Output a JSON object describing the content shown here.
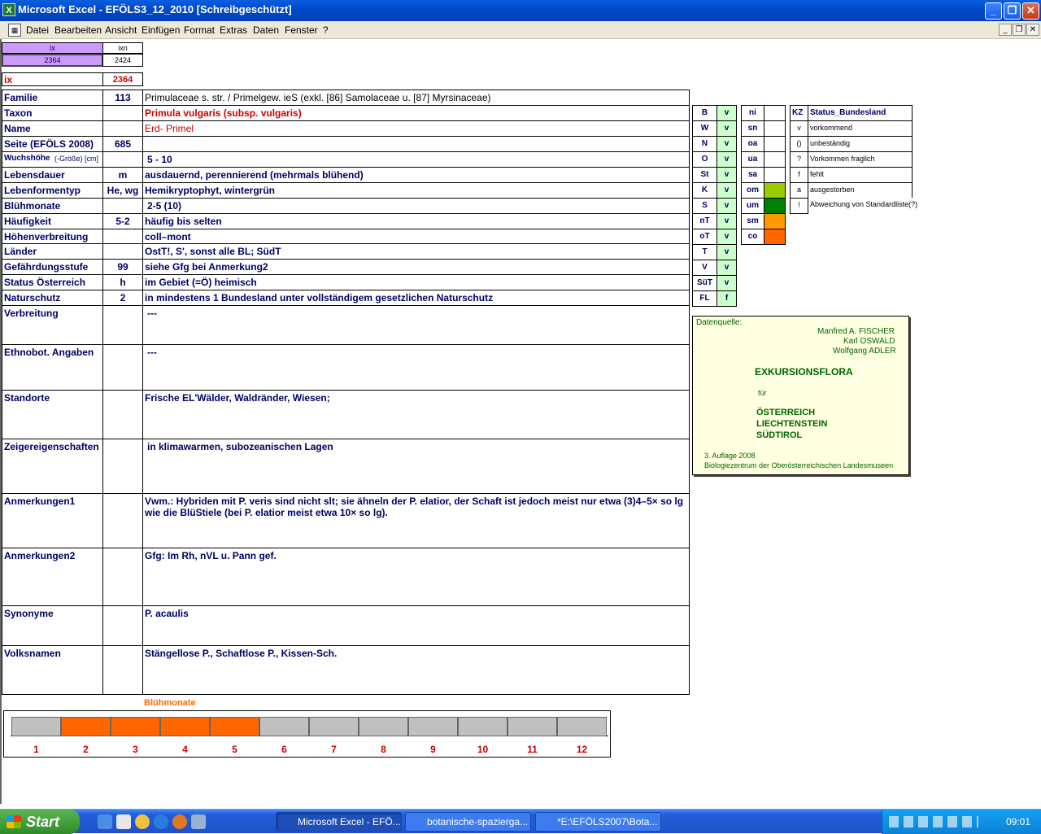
{
  "window": {
    "title": "Microsoft Excel - EFÖLS3_12_2010  [Schreibgeschützt]",
    "app_icon": "X"
  },
  "menu": [
    "Datei",
    "Bearbeiten",
    "Ansicht",
    "Einfügen",
    "Format",
    "Extras",
    "Daten",
    "Fenster",
    "?"
  ],
  "top": {
    "ix_header": "ix",
    "ixn_header": "ixn",
    "ix_value": "2364",
    "ixn_value": "2424",
    "ix_label": "ix",
    "ix_red": "2364"
  },
  "rows": [
    {
      "label": "Familie",
      "code": "113",
      "value": "Primulaceae s. str.  /  Primelgew. ieS (exkl. [86] Samolaceae u. [87] Myrsinaceae)"
    },
    {
      "label": "Taxon",
      "code": "",
      "value": "Primula vulgaris (subsp. vulgaris)"
    },
    {
      "label": "Name",
      "code": "",
      "value": "Erd- Primel"
    },
    {
      "label": "Seite (EFÖLS 2008)",
      "code": "685",
      "value": ""
    },
    {
      "label": "Wuchshöhe",
      "label_small": "(-Größe) [cm]",
      "code": "",
      "value": "5 - 10"
    },
    {
      "label": "Lebensdauer",
      "code": "m",
      "value": "ausdauernd, perennierend (mehrmals blühend)"
    },
    {
      "label": "Lebenformentyp",
      "code": "He, wg",
      "value": "Hemikryptophyt, wintergrün"
    },
    {
      "label": "Blühmonate",
      "code": "",
      "value": "2-5 (10)"
    },
    {
      "label": "Häufigkeit",
      "code": "5-2",
      "value": "häufig bis selten"
    },
    {
      "label": "Höhenverbreitung",
      "code": "",
      "value": "coll–mont"
    },
    {
      "label": "Länder",
      "code": "",
      "value": "OstT!, S', sonst alle BL; SüdT"
    },
    {
      "label": "Gefährdungsstufe",
      "code": "99",
      "value": "siehe Gfg bei Anmerkung2"
    },
    {
      "label": "Status Österreich",
      "code": "h",
      "value": "im Gebiet (=Ö) heimisch"
    },
    {
      "label": "Naturschutz",
      "code": "2",
      "value": "in mindestens 1 Bundesland unter vollständigem gesetzlichen Naturschutz"
    },
    {
      "label": "Verbreitung",
      "code": "",
      "value": "---"
    },
    {
      "label": "Ethnobot. Angaben",
      "code": "",
      "value": "---"
    },
    {
      "label": "Standorte",
      "code": "",
      "value": "Frische EL'Wälder, Waldränder, Wiesen;"
    },
    {
      "label": "Zeigereigenschaften",
      "code": "",
      "value": "in klimawarmen, subozeanischen Lagen"
    },
    {
      "label": "Anmerkungen1",
      "code": "",
      "value": "Vwm.: Hybriden mit P. veris sind nicht slt; sie ähneln der P. elatior, der Schaft ist jedoch meist nur etwa (3)4–5× so lg wie die BlüStiele (bei P. elatior meist etwa 10× so lg)."
    },
    {
      "label": "Anmerkungen2",
      "code": "",
      "value": "Gfg: Im Rh, nVL u. Pann gef."
    },
    {
      "label": "Synonyme",
      "code": "",
      "value": "P. acaulis"
    },
    {
      "label": "Volksnamen",
      "code": "",
      "value": "Stängellose P., Schaftlose P., Kissen-Sch."
    }
  ],
  "states": [
    {
      "code": "B",
      "val": "v"
    },
    {
      "code": "W",
      "val": "v"
    },
    {
      "code": "N",
      "val": "v"
    },
    {
      "code": "O",
      "val": "v"
    },
    {
      "code": "St",
      "val": "v"
    },
    {
      "code": "K",
      "val": "v"
    },
    {
      "code": "S",
      "val": "v"
    },
    {
      "code": "nT",
      "val": "v"
    },
    {
      "code": "oT",
      "val": "v"
    },
    {
      "code": "T",
      "val": "v"
    },
    {
      "code": "V",
      "val": "v"
    },
    {
      "code": "SüT",
      "val": "v"
    },
    {
      "code": "FL",
      "val": "f"
    }
  ],
  "zones": [
    {
      "code": "ni",
      "color": "#ffffff"
    },
    {
      "code": "sn",
      "color": "#ffffff"
    },
    {
      "code": "oa",
      "color": "#ffffff"
    },
    {
      "code": "ua",
      "color": "#ffffff"
    },
    {
      "code": "sa",
      "color": "#ffffff"
    },
    {
      "code": "om",
      "color": "#99cc00"
    },
    {
      "code": "um",
      "color": "#008000"
    },
    {
      "code": "sm",
      "color": "#ff9900"
    },
    {
      "code": "co",
      "color": "#ff6600"
    }
  ],
  "legend": {
    "header_kz": "KZ",
    "header_status": "Status_Bundesland",
    "items": [
      {
        "kz": "v",
        "text": "vorkommend"
      },
      {
        "kz": "()",
        "text": "unbeständig"
      },
      {
        "kz": "?",
        "text": "Vorkommen fraglich"
      },
      {
        "kz": "f",
        "text": "fehlt"
      },
      {
        "kz": "a",
        "text": "ausgestorben"
      },
      {
        "kz": "!",
        "text": "Abweichung von Standardliste(?)"
      }
    ]
  },
  "datasource": {
    "label": "Datenquelle:",
    "author1": "Manfred A. FISCHER",
    "author2": "Karl OSWALD",
    "author3": "Wolfgang ADLER",
    "title": "EXKURSIONSFLORA",
    "fuer": "für",
    "c1": "ÖSTERREICH",
    "c2": "LIECHTENSTEIN",
    "c3": "SÜDTIROL",
    "edition": "3. Auflage 2008",
    "publisher": "Biologiezentrum der Oberösterreichischen Landesmuseen"
  },
  "bloom": {
    "title": "Blühmonate",
    "months": [
      "1",
      "2",
      "3",
      "4",
      "5",
      "6",
      "7",
      "8",
      "9",
      "10",
      "11",
      "12"
    ],
    "active": [
      false,
      true,
      true,
      true,
      true,
      false,
      false,
      false,
      false,
      false,
      false,
      false
    ],
    "active_color": "#ff6600",
    "inactive_color": "#c0c0c0"
  },
  "taskbar": {
    "start": "Start",
    "tasks": [
      "Microsoft Excel - EFÖ...",
      "botanische-spazierga...",
      "*E:\\EFÖLS2007\\Bota..."
    ],
    "clock": "09:01"
  }
}
